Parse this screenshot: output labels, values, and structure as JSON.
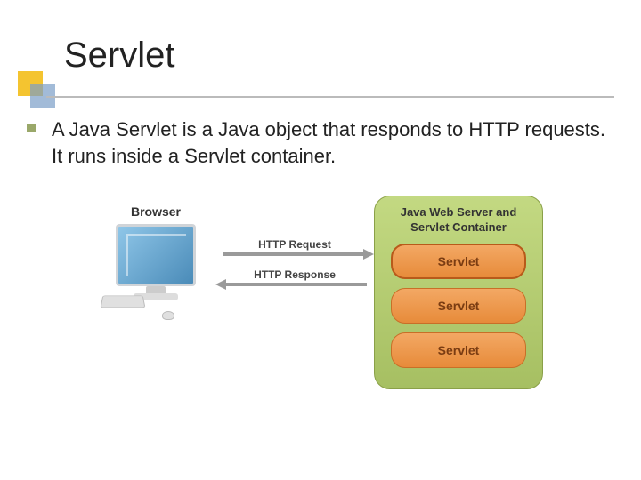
{
  "title": "Servlet",
  "bullet": "A Java Servlet is a Java object that responds to HTTP requests. It runs inside a Servlet container.",
  "diagram": {
    "browser_label": "Browser",
    "server_label": "Java Web Server and Servlet Container",
    "request_label": "HTTP Request",
    "response_label": "HTTP Response",
    "servlets": [
      "Servlet",
      "Servlet",
      "Servlet"
    ]
  }
}
